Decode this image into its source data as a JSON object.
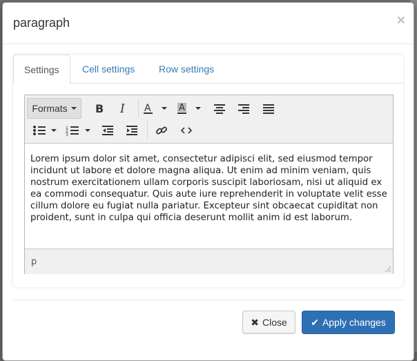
{
  "modal": {
    "title": "paragraph",
    "close_symbol": "×"
  },
  "tabs": [
    {
      "label": "Settings",
      "active": true
    },
    {
      "label": "Cell settings",
      "active": false
    },
    {
      "label": "Row settings",
      "active": false
    }
  ],
  "toolbar": {
    "formats_label": "Formats",
    "buttons": [
      "bold-icon",
      "italic-icon",
      "text-color-icon",
      "background-color-icon",
      "align-center-icon",
      "align-right-icon",
      "align-justify-icon",
      "bullet-list-icon",
      "numbered-list-icon",
      "outdent-icon",
      "indent-icon",
      "link-icon",
      "source-code-icon"
    ]
  },
  "editor": {
    "content": "Lorem ipsum dolor sit amet, consectetur adipisci elit, sed eiusmod tempor incidunt ut labore et dolore magna aliqua. Ut enim ad minim veniam, quis nostrum exercitationem ullam corporis suscipit laboriosam, nisi ut aliquid ex ea commodi consequatur. Quis aute iure reprehenderit in voluptate velit esse cillum dolore eu fugiat nulla pariatur. Excepteur sint obcaecat cupiditat non proident, sunt in culpa qui officia deserunt mollit anim id est laborum.",
    "path": "p"
  },
  "footer": {
    "close_label": "Close",
    "apply_label": "Apply changes"
  },
  "colors": {
    "primary": "#2f70b5",
    "link": "#337ab7"
  }
}
